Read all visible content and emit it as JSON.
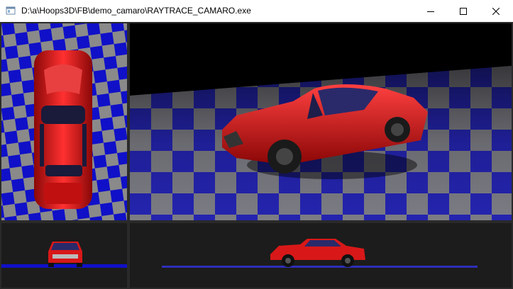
{
  "window": {
    "title": "D:\\a\\Hoops3D\\FB\\demo_camaro\\RAYTRACE_CAMARO.exe",
    "icon": "application-window-icon",
    "controls": {
      "minimize": "minimize-icon",
      "maximize": "maximize-icon",
      "close": "close-icon"
    }
  },
  "viewports": [
    {
      "name": "top",
      "contents": "car-top-view"
    },
    {
      "name": "perspective",
      "contents": "car-perspective-view"
    },
    {
      "name": "front",
      "contents": "car-front-view"
    },
    {
      "name": "side",
      "contents": "car-side-view"
    }
  ],
  "colors": {
    "car_body": "#d81818",
    "checker_a": "#1010c8",
    "checker_b": "#8a8a8a",
    "viewport_bg": "#1c1c1c"
  }
}
